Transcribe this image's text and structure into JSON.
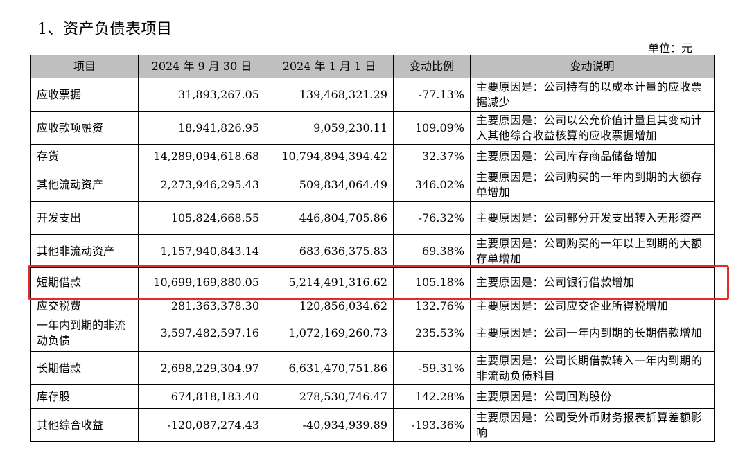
{
  "document": {
    "section_title": "1、资产负债表项目",
    "unit": "单位：元"
  },
  "table": {
    "headers": [
      "项目",
      "2024 年 9 月 30 日",
      "2024 年 1 月 1 日",
      "变动比例",
      "变动说明"
    ],
    "rows": [
      {
        "item": "应收票据",
        "end": "31,893,267.05",
        "begin": "139,468,321.29",
        "change": "-77.13%",
        "desc": "主要原因是：公司持有的以成本计量的应收票据减少"
      },
      {
        "item": "应收款项融资",
        "end": "18,941,826.95",
        "begin": "9,059,230.11",
        "change": "109.09%",
        "desc": "主要原因是：公司以公允价值计量且其变动计入其他综合收益核算的应收票据增加"
      },
      {
        "item": "存货",
        "end": "14,289,094,618.68",
        "begin": "10,794,894,394.42",
        "change": "32.37%",
        "desc": "主要原因是：公司库存商品储备增加"
      },
      {
        "item": "其他流动资产",
        "end": "2,273,946,295.43",
        "begin": "509,834,064.49",
        "change": "346.02%",
        "desc": "主要原因是：公司购买的一年内到期的大额存单增加"
      },
      {
        "item": "开发支出",
        "end": "105,824,668.55",
        "begin": "446,804,705.86",
        "change": "-76.32%",
        "desc": "主要原因是：公司部分开发支出转入无形资产"
      },
      {
        "item": "其他非流动资产",
        "end": "1,157,940,843.14",
        "begin": "683,636,375.83",
        "change": "69.38%",
        "desc": "主要原因是：公司购买的一年以上到期的大额存单增加"
      },
      {
        "item": "短期借款",
        "end": "10,699,169,880.05",
        "begin": "5,214,491,316.62",
        "change": "105.18%",
        "desc": "主要原因是：公司银行借款增加"
      },
      {
        "item": "应交税费",
        "end": "281,363,378.30",
        "begin": "120,856,034.62",
        "change": "132.76%",
        "desc": "主要原因是：公司应交企业所得税增加"
      },
      {
        "item": "一年内到期的非流动负债",
        "end": "3,597,482,597.16",
        "begin": "1,072,169,260.73",
        "change": "235.53%",
        "desc": "主要原因是：公司一年内到期的长期借款增加"
      },
      {
        "item": "长期借款",
        "end": "2,698,229,304.97",
        "begin": "6,631,470,751.86",
        "change": "-59.31%",
        "desc": "主要原因是：公司长期借款转入一年内到期的非流动负债科目"
      },
      {
        "item": "库存股",
        "end": "674,818,183.40",
        "begin": "278,530,746.47",
        "change": "142.28%",
        "desc": "主要原因是：公司回购股份"
      },
      {
        "item": "其他综合收益",
        "end": "-120,087,274.43",
        "begin": "-40,934,939.89",
        "change": "-193.36%",
        "desc": "主要原因是：公司受外币财务报表折算差额影响"
      }
    ]
  },
  "annotation": {
    "highlight_color": "#e52a2a",
    "highlighted_row": "短期借款"
  }
}
